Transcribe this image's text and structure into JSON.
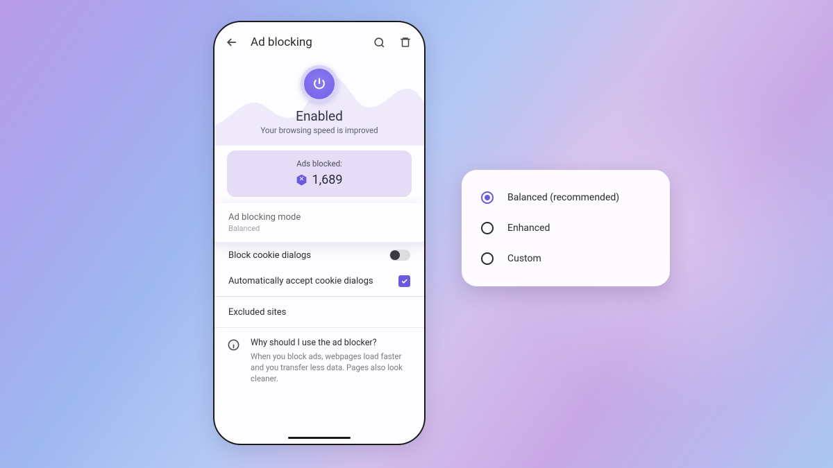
{
  "header": {
    "title": "Ad blocking"
  },
  "hero": {
    "status": "Enabled",
    "subtitle": "Your browsing speed is improved"
  },
  "stats": {
    "label": "Ads blocked:",
    "count": "1,689"
  },
  "mode_row": {
    "title": "Ad blocking mode",
    "value": "Balanced"
  },
  "cookie_block": {
    "label": "Block cookie dialogs"
  },
  "cookie_accept": {
    "label": "Automatically accept cookie dialogs"
  },
  "excluded": {
    "label": "Excluded sites"
  },
  "info": {
    "question": "Why should I use the ad blocker?",
    "answer": "When you block ads, webpages load faster and you transfer less data. Pages also look cleaner."
  },
  "popup": {
    "options": [
      "Balanced (recommended)",
      "Enhanced",
      "Custom"
    ]
  }
}
